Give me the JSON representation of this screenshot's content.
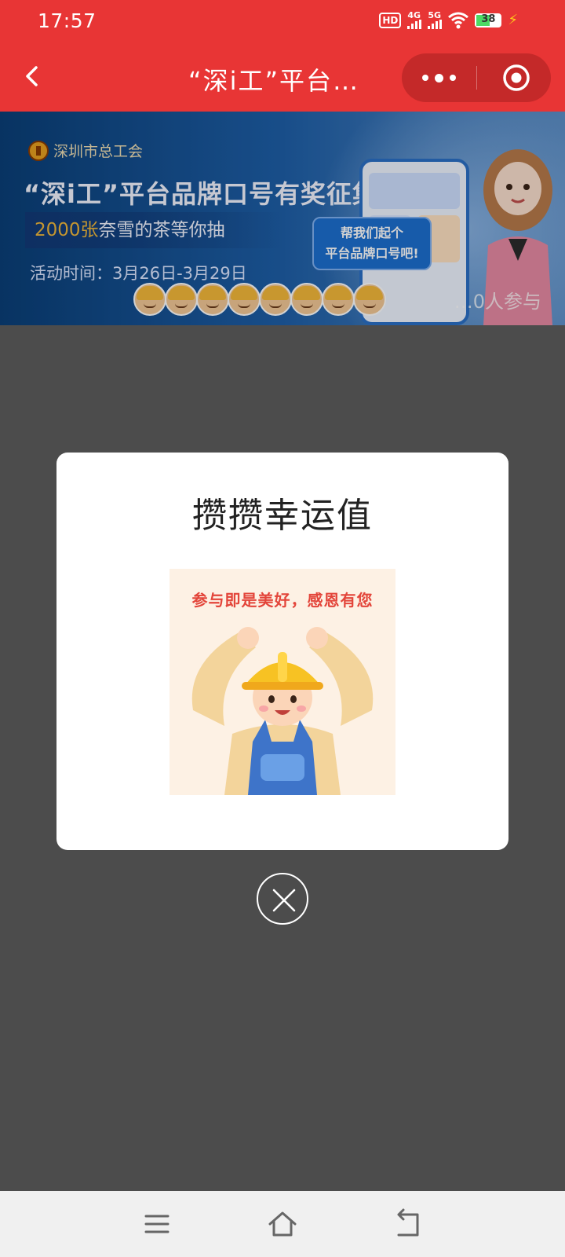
{
  "status_bar": {
    "time": "17:57",
    "hd_label": "HD",
    "network_4g": "4G",
    "network_5g": "5G",
    "battery_level": "38"
  },
  "nav": {
    "title": "“深i工”平台…"
  },
  "banner": {
    "org": "深圳市总工会",
    "headline": "“深i工”平台品牌口号有奖征集",
    "prize_gold": "2000张",
    "prize_rest": "奈雪的茶等你抽",
    "period": "活动时间：3月26日-3月29日",
    "bubble_line1": "帮我们起个",
    "bubble_line2": "平台品牌口号吧!",
    "participants": "…0人参与"
  },
  "modal": {
    "title": "攒攒幸运值",
    "image_caption": "参与即是美好，感恩有您"
  },
  "colors": {
    "brand_red": "#e83535",
    "capsule_red": "#c42929",
    "overlay": "#4c4c4c"
  }
}
